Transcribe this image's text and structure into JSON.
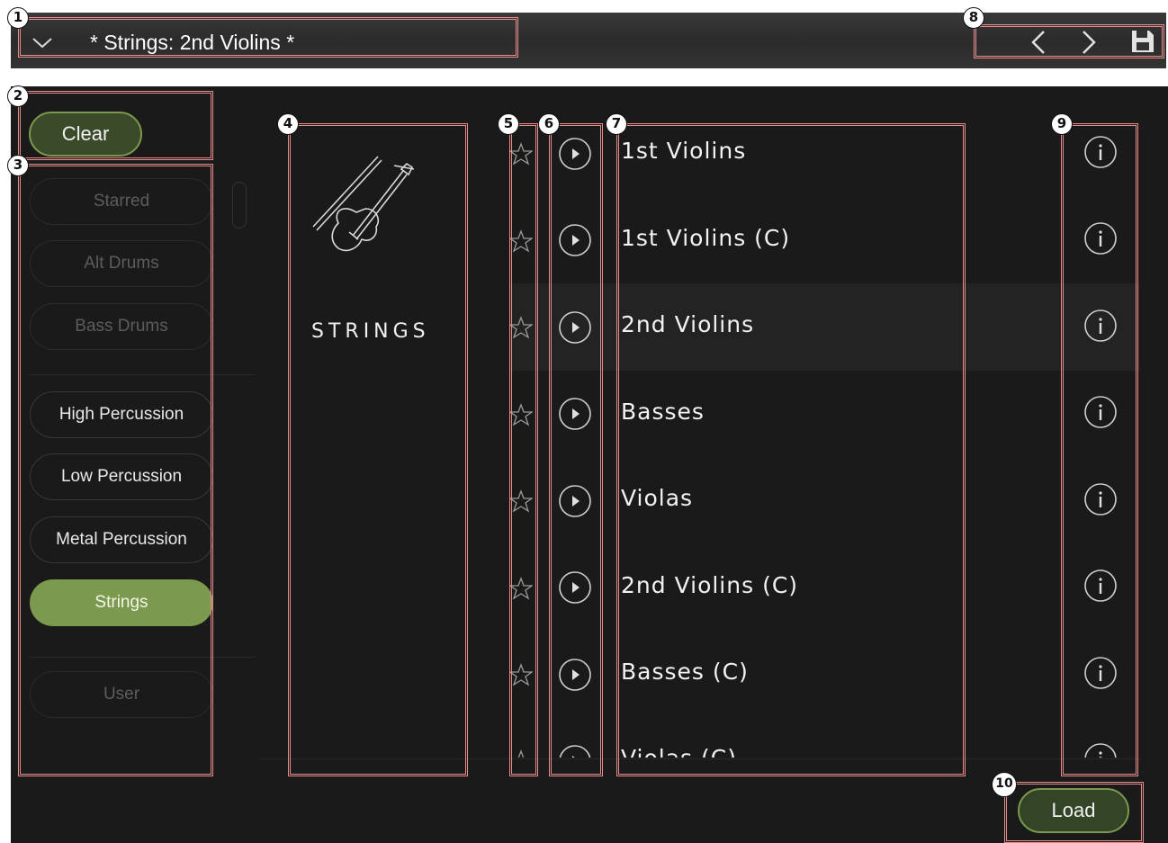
{
  "header": {
    "title": "* Strings: 2nd Violins *",
    "dropdown_icon": "chevron-down-icon",
    "prev_icon": "chevron-left-icon",
    "next_icon": "chevron-right-icon",
    "save_icon": "floppy-disk-icon"
  },
  "clear_label": "Clear",
  "filters": [
    {
      "label": "Starred",
      "state": "disabled"
    },
    {
      "label": "Alt Drums",
      "state": "disabled"
    },
    {
      "label": "Bass Drums",
      "state": "disabled"
    },
    {
      "label": "High Percussion",
      "state": "enabled"
    },
    {
      "label": "Low Percussion",
      "state": "enabled"
    },
    {
      "label": "Metal Percussion",
      "state": "enabled"
    },
    {
      "label": "Strings",
      "state": "selected"
    },
    {
      "label": "User",
      "state": "disabled"
    }
  ],
  "category": {
    "label": "STRINGS",
    "icon": "violin-icon"
  },
  "presets": [
    {
      "name": "1st Violins",
      "selected": false
    },
    {
      "name": "1st Violins (C)",
      "selected": false
    },
    {
      "name": "2nd Violins",
      "selected": true
    },
    {
      "name": "Basses",
      "selected": false
    },
    {
      "name": "Violas",
      "selected": false
    },
    {
      "name": "2nd Violins (C)",
      "selected": false
    },
    {
      "name": "Basses (C)",
      "selected": false
    },
    {
      "name": "Violas (C)",
      "selected": false
    }
  ],
  "load_label": "Load",
  "callouts": [
    "1",
    "2",
    "3",
    "4",
    "5",
    "6",
    "7",
    "8",
    "9",
    "10"
  ],
  "colors": {
    "accent_green": "#7b9a4d",
    "panel_bg": "#1b1a1a",
    "annotation_red": "#e88b8b"
  }
}
